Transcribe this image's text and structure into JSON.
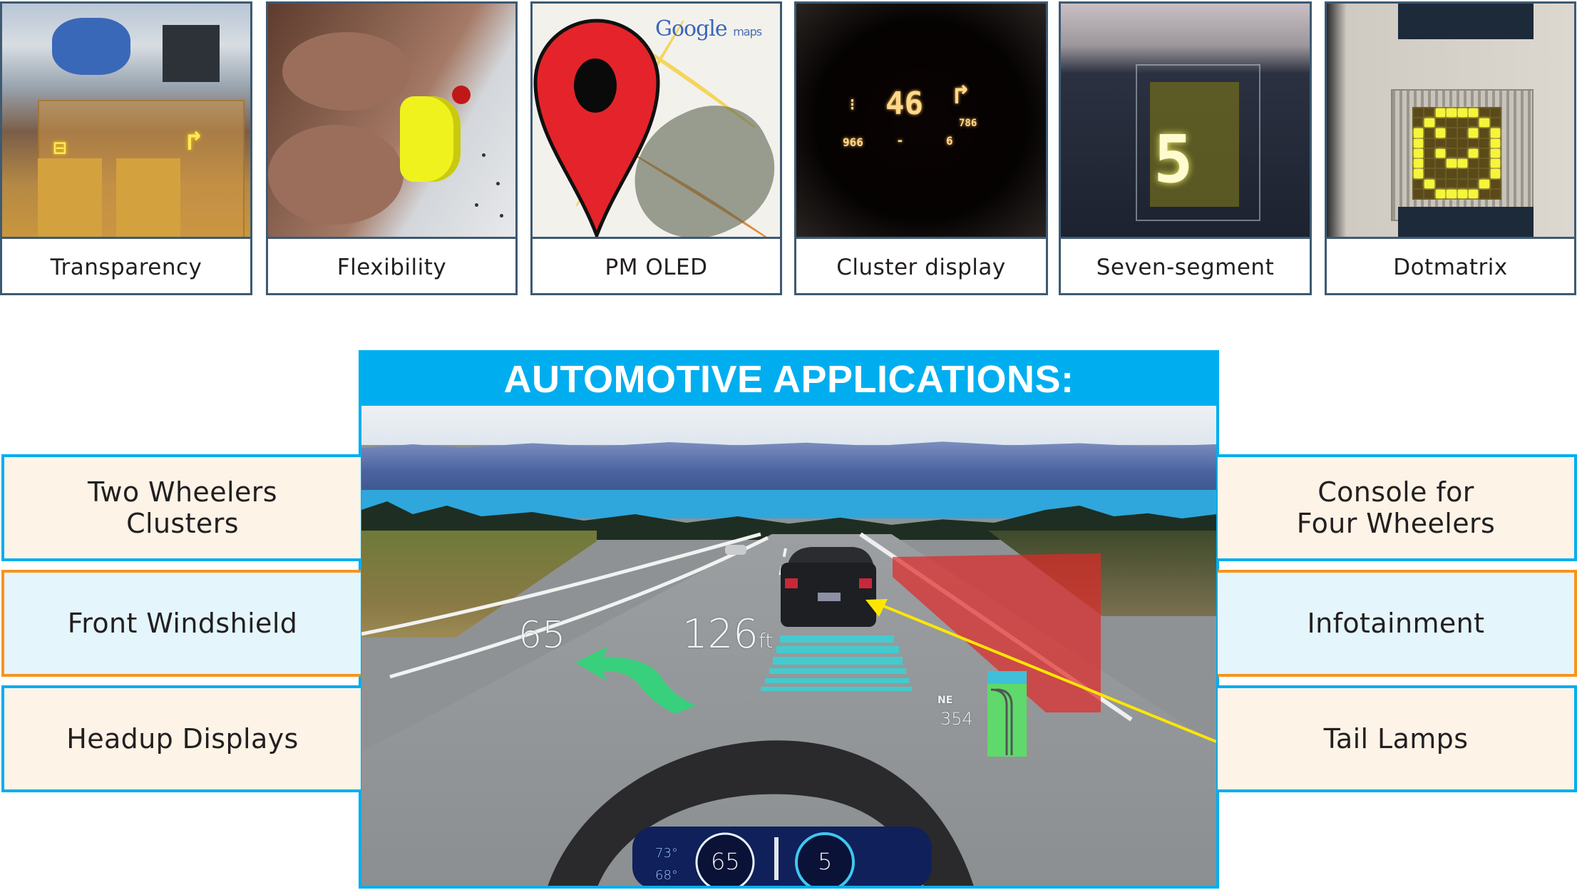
{
  "features": [
    {
      "label": "Transparency",
      "photo": "transparent-oled-panel"
    },
    {
      "label": "Flexibility",
      "photo": "flexible-oled-roll"
    },
    {
      "label": "PM OLED",
      "photo": "map-pin-display"
    },
    {
      "label": "Cluster display",
      "photo": "instrument-cluster-display"
    },
    {
      "label": "Seven-segment",
      "photo": "seven-segment-oled"
    },
    {
      "label": "Dotmatrix",
      "photo": "dot-matrix-oled"
    }
  ],
  "photo_text": {
    "map_brand": "Google",
    "map_brand_suffix": "maps",
    "cluster_speed": "46",
    "cluster_left": "966",
    "cluster_dash": "-",
    "cluster_right": "6",
    "cluster_small": "786",
    "seven_segment_digit": "5"
  },
  "automotive": {
    "title": "AUTOMOTIVE APPLICATIONS:",
    "hud": {
      "speed": "65",
      "distance": "126",
      "distance_unit": "ft",
      "heading": "NE",
      "range": "354",
      "dash_temp_1": "73°",
      "dash_temp_2": "68°",
      "dash_speed": "65",
      "dash_gear": "5"
    }
  },
  "applications": {
    "left": [
      {
        "label_lines": [
          "Two Wheelers",
          "Clusters"
        ],
        "style": "blue"
      },
      {
        "label_lines": [
          "Front Windshield"
        ],
        "style": "orange"
      },
      {
        "label_lines": [
          "Headup Displays"
        ],
        "style": "blue"
      }
    ],
    "right": [
      {
        "label_lines": [
          "Console for",
          "Four Wheelers"
        ],
        "style": "blue"
      },
      {
        "label_lines": [
          "Infotainment"
        ],
        "style": "orange"
      },
      {
        "label_lines": [
          "Tail Lamps"
        ],
        "style": "blue"
      }
    ]
  },
  "colors": {
    "accent_blue": "#00aeef",
    "accent_orange": "#f7941d",
    "panel_border": "#3d5a72",
    "box_cream": "#fdf3e7",
    "box_lightblue": "#e4f5fc",
    "arrow_yellow": "#ffe600"
  }
}
